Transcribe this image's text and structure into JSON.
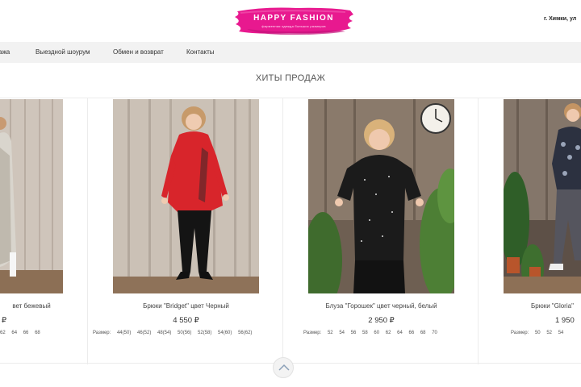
{
  "header": {
    "logo_title": "HAPPY FASHION",
    "logo_subtitle": "фирменная одежда больших размеров",
    "address": "г. Химки, ул"
  },
  "nav": {
    "items": [
      {
        "label": "ажа"
      },
      {
        "label": "Выездной шоурум"
      },
      {
        "label": "Обмен и возврат"
      },
      {
        "label": "Контакты"
      }
    ]
  },
  "section_title": "ХИТЫ ПРОДАЖ",
  "products": [
    {
      "name": "вет бежевый",
      "price": "₽",
      "sizes": [
        "62",
        "64",
        "66",
        "68"
      ]
    },
    {
      "name": "Брюки \"Bridget\" цвет Черный",
      "price": "4 550 ₽",
      "size_label": "Размер:",
      "sizes": [
        "44(50)",
        "46(52)",
        "48(54)",
        "50(56)",
        "52(58)",
        "54(60)",
        "56(62)"
      ]
    },
    {
      "name": "Блуза \"Горошек\" цвет черный, белый",
      "price": "2 950 ₽",
      "size_label": "Размер:",
      "sizes": [
        "52",
        "54",
        "56",
        "58",
        "60",
        "62",
        "64",
        "66",
        "68",
        "70"
      ]
    },
    {
      "name": "Брюки \"Gloria\"",
      "price": "1 950",
      "size_label": "Размер:",
      "sizes": [
        "50",
        "52",
        "54"
      ]
    }
  ],
  "colors": {
    "brand_pink": "#e8198f",
    "nav_background": "#f2f2f2",
    "top_red": "#d8252b",
    "photo_wood": "#c7bdb3"
  }
}
